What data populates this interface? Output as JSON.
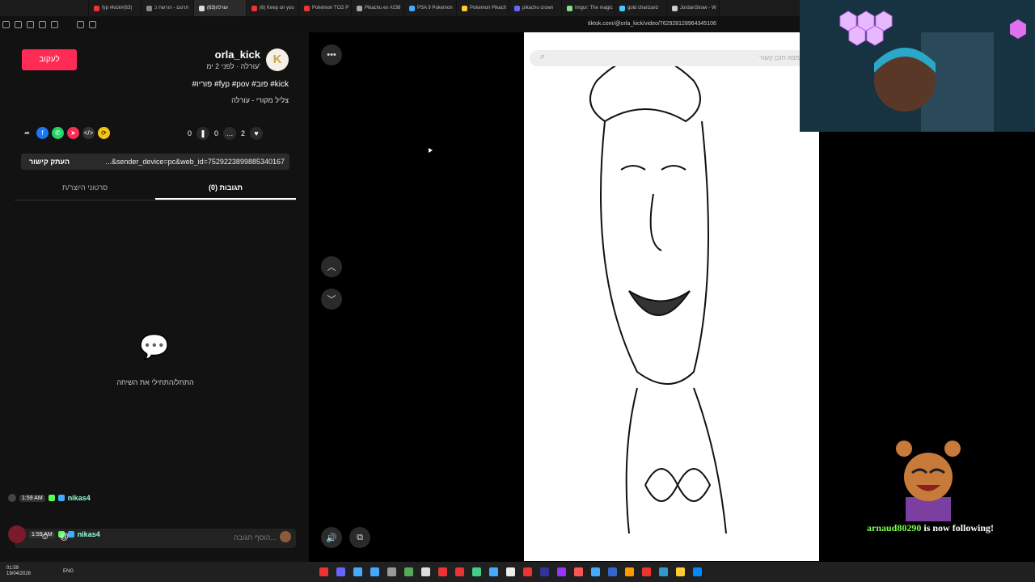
{
  "browser": {
    "tabs": [
      {
        "label": "fyp #kick#(63)",
        "color": "#e33"
      },
      {
        "label": "תרגום - הורשת כ",
        "color": "#888"
      },
      {
        "label": "(63)עורלה",
        "color": "#ddd",
        "active": true
      },
      {
        "label": "(6) Keep on you",
        "color": "#e33"
      },
      {
        "label": "Pokémon TCG P",
        "color": "#e33"
      },
      {
        "label": "Pikachu ex #238",
        "color": "#aaa"
      },
      {
        "label": "PSA 9 Pokemon",
        "color": "#4af"
      },
      {
        "label": "Pokemon Pikach",
        "color": "#fc3"
      },
      {
        "label": "pikachu crown",
        "color": "#66f"
      },
      {
        "label": "Imgur: The magic",
        "color": "#8d8"
      },
      {
        "label": "gold charizard",
        "color": "#4cf"
      },
      {
        "label": "JordanStraw - W",
        "color": "#ccc"
      }
    ],
    "url": "tiktok.com/@orla_kick/video/7629281289643451​06"
  },
  "post": {
    "follow_label": "לעקוב",
    "username": "orla_kick",
    "subtitle": "עורלה · לפני 2 ימ'",
    "avatar_letter": "K",
    "tags": "#פוריו #fyp #pov #פוב #kick",
    "music": "צליל מקורי - עורלה",
    "likes": "2",
    "comments": "0",
    "saves": "0",
    "copy_link_label": "העתק קישור",
    "link_text": "...&sender_device=pc&web_id=7529223899885340167",
    "tab_creator": "סרטוני היוצר/ת",
    "tab_comments": "(0) תגובות",
    "empty_text": "התחל/התחילי את השיחה",
    "comment_placeholder": "הוסף תגובה..."
  },
  "share_colors": [
    "#fe2c55",
    "#f5c518",
    "#ddd",
    "#fe2c55",
    "#25d366",
    "#1877f2"
  ],
  "chat": [
    {
      "time": "1:59 AM",
      "name": "nikas4"
    },
    {
      "time": "1:59 AM",
      "name": "nikas4"
    }
  ],
  "video": {
    "search_placeholder": "מצא תוכן קשור"
  },
  "stream": {
    "follower_name": "arnaud80290",
    "follower_text": " is now following!"
  },
  "taskbar": {
    "lang": "ENG",
    "time": "01:59",
    "date": "19/04/2026"
  }
}
